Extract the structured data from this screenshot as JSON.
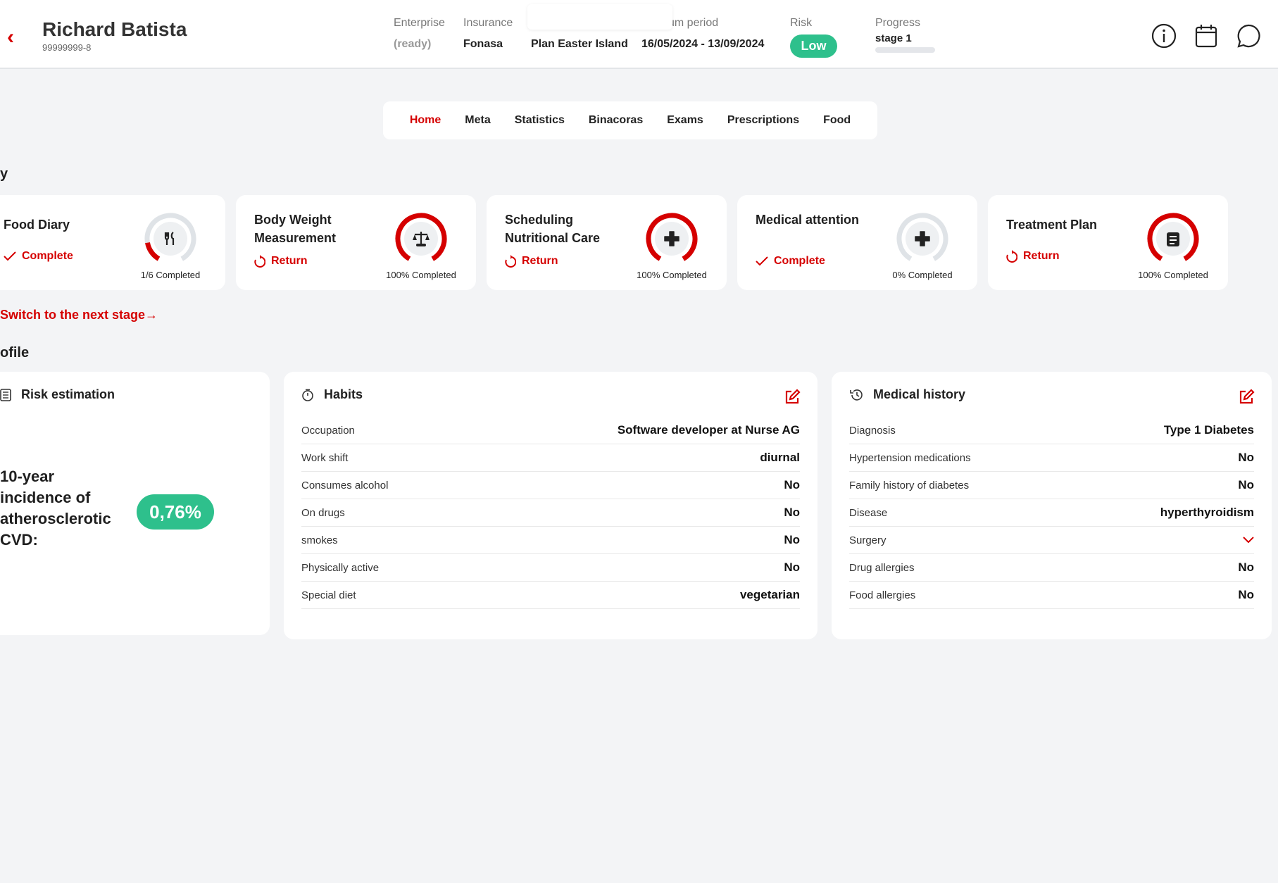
{
  "header": {
    "name": "Richard Batista",
    "id": "99999999-8",
    "fields": [
      {
        "label": "Enterprise",
        "value": "(ready)"
      },
      {
        "label": "Insurance",
        "value": "Fonasa"
      },
      {
        "label": "",
        "value": "Plan Easter Island"
      },
      {
        "label": "um period",
        "value": "16/05/2024 - 13/09/2024"
      }
    ],
    "risk_label": "Risk",
    "risk_value": "Low",
    "progress_label": "Progress",
    "progress_value": "stage 1",
    "progress_fraction": 0,
    "icons": [
      "info-icon",
      "calendar-icon",
      "chat-icon"
    ]
  },
  "tabs": [
    {
      "label": "Home",
      "active": true
    },
    {
      "label": "Meta"
    },
    {
      "label": "Statistics"
    },
    {
      "label": "Binacoras"
    },
    {
      "label": "Exams"
    },
    {
      "label": "Prescriptions"
    },
    {
      "label": "Food"
    }
  ],
  "section1": "y",
  "cards": [
    {
      "title": "Food Diary",
      "action": "Complete",
      "action_icon": "check-icon",
      "caption": "1/6 Completed",
      "progress": 0.1667,
      "icon": "utensils-icon"
    },
    {
      "title": "Body Weight Measurement",
      "action": "Return",
      "action_icon": "refresh-icon",
      "caption": "100% Completed",
      "progress": 1,
      "icon": "scale-icon"
    },
    {
      "title": "Scheduling Nutritional Care",
      "action": "Return",
      "action_icon": "refresh-icon",
      "caption": "100% Completed",
      "progress": 1,
      "icon": "medical-cross-icon"
    },
    {
      "title": "Medical attention",
      "action": "Complete",
      "action_icon": "check-icon",
      "caption": "0% Completed",
      "progress": 0,
      "icon": "medical-cross-icon"
    },
    {
      "title": "Treatment Plan",
      "action": "Return",
      "action_icon": "refresh-icon",
      "caption": "100% Completed",
      "progress": 1,
      "icon": "clipboard-icon"
    }
  ],
  "next_stage": "Switch to the next stage→",
  "section2": "ofile",
  "risk": {
    "title": "Risk estimation",
    "text": "10-year incidence of atherosclerotic CVD:",
    "value": "0,76%"
  },
  "habits": {
    "title": "Habits",
    "rows": [
      [
        "Occupation",
        "Software developer at Nurse AG"
      ],
      [
        "Work shift",
        "diurnal"
      ],
      [
        "Consumes alcohol",
        "No"
      ],
      [
        "On drugs",
        "No"
      ],
      [
        "smokes",
        "No"
      ],
      [
        "Physically active",
        "No"
      ],
      [
        "Special diet",
        "vegetarian"
      ]
    ]
  },
  "medical": {
    "title": "Medical history",
    "rows": [
      [
        "Diagnosis",
        "Type 1 Diabetes"
      ],
      [
        "Hypertension medications",
        "No"
      ],
      [
        "Family history of diabetes",
        "No"
      ],
      [
        "Disease",
        "hyperthyroidism"
      ],
      [
        "Surgery",
        ""
      ],
      [
        "Drug allergies",
        "No"
      ],
      [
        "Food allergies",
        "No"
      ]
    ]
  },
  "colors": {
    "accent": "#d50000",
    "success": "#2ec08c",
    "track": "#dfe3e7"
  }
}
